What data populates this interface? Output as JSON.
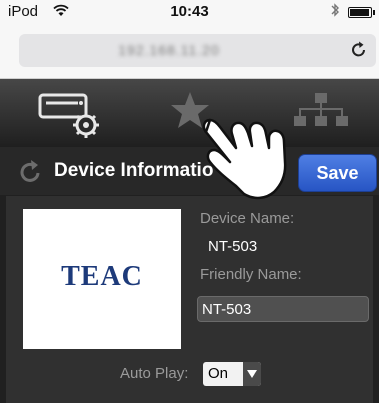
{
  "status": {
    "carrier": "iPod",
    "time": "10:43"
  },
  "browser": {
    "url": "192.168.11.20",
    "icons": [
      "wifi-icon",
      "bluetooth-icon",
      "battery-icon",
      "reload-icon"
    ]
  },
  "tabs": [
    {
      "name": "device-settings",
      "icon": "settings-device-icon"
    },
    {
      "name": "favorites",
      "icon": "star-icon"
    },
    {
      "name": "network",
      "icon": "network-icon"
    }
  ],
  "page": {
    "title": "Device Informatio",
    "save_label": "Save"
  },
  "device": {
    "logo_text": "TEAC",
    "device_name_label": "Device Name:",
    "device_name_value": "NT-503",
    "friendly_name_label": "Friendly Name:",
    "friendly_name_value": "NT-503",
    "auto_play_label": "Auto Play:",
    "auto_play_value": "On"
  },
  "colors": {
    "accent": "#3566d6",
    "background": "#202020",
    "panel": "#303030"
  }
}
